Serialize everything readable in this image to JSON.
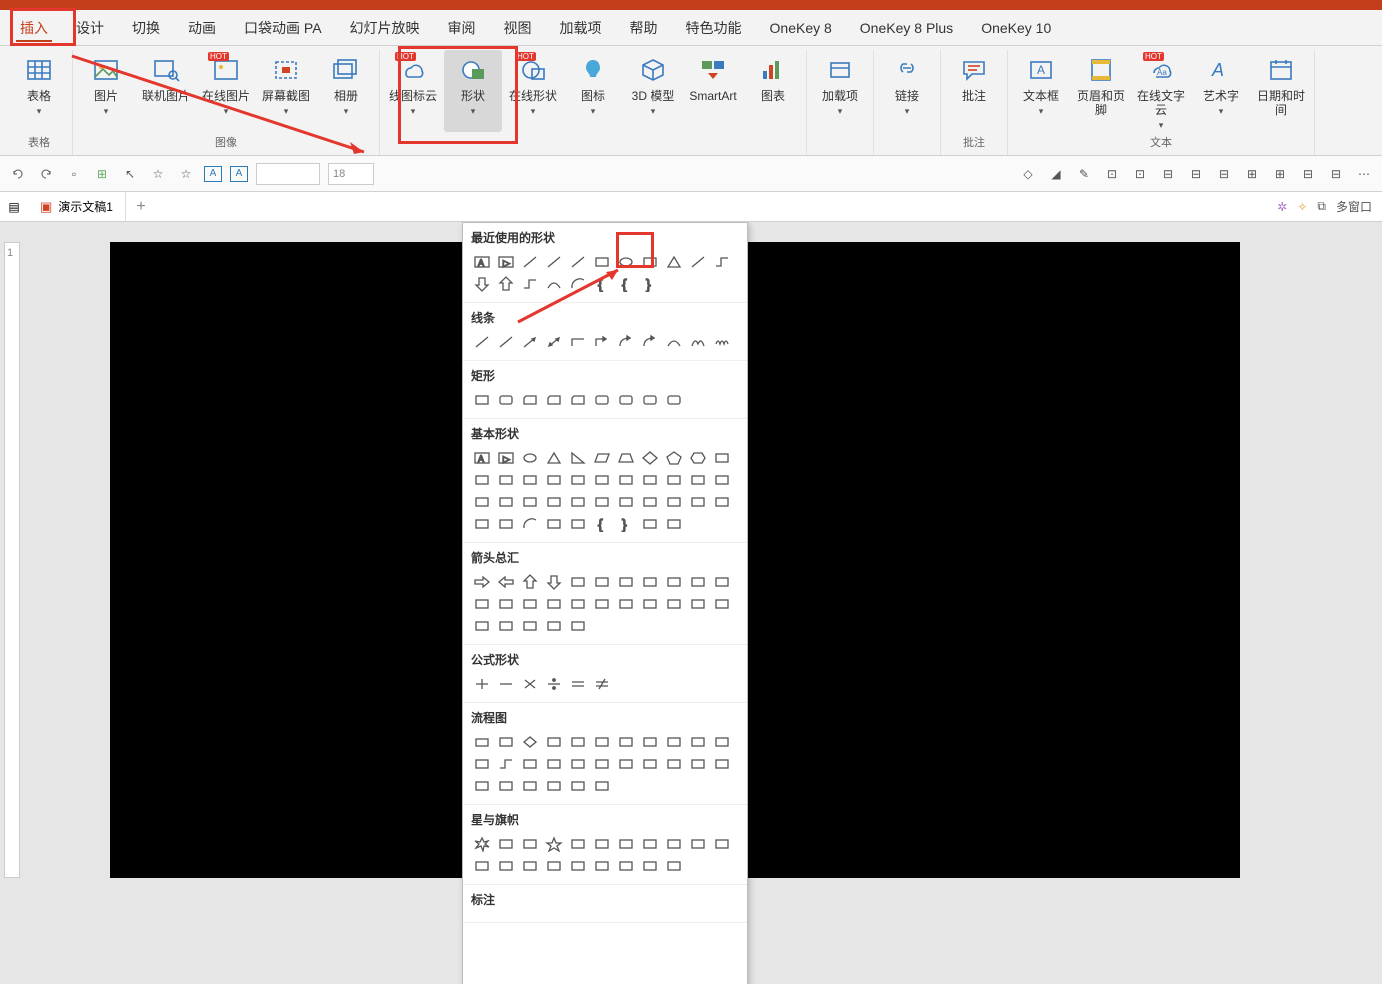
{
  "menubar": {
    "tabs": [
      "插入",
      "设计",
      "切换",
      "动画",
      "口袋动画 PA",
      "幻灯片放映",
      "审阅",
      "视图",
      "加载项",
      "帮助",
      "特色功能",
      "OneKey 8",
      "OneKey 8 Plus",
      "OneKey 10"
    ],
    "active_index": 0
  },
  "ribbon": {
    "groups": [
      {
        "name": "表格",
        "items": [
          {
            "label": "表格",
            "icon": "table",
            "chev": true
          }
        ]
      },
      {
        "name": "图像",
        "items": [
          {
            "label": "图片",
            "icon": "image",
            "chev": true
          },
          {
            "label": "联机图片",
            "icon": "image-search",
            "chev": false
          },
          {
            "label": "在线图片",
            "icon": "image-online",
            "chev": true,
            "hot": true
          },
          {
            "label": "屏幕截图",
            "icon": "screenshot",
            "chev": true
          },
          {
            "label": "相册",
            "icon": "album",
            "chev": true
          }
        ]
      },
      {
        "name": "",
        "items": [
          {
            "label": "线图标云",
            "icon": "cloud-icons",
            "chev": true,
            "hot": true
          },
          {
            "label": "形状",
            "icon": "shapes",
            "chev": true,
            "active": true
          },
          {
            "label": "在线形状",
            "icon": "shapes-online",
            "chev": true,
            "hot": true
          },
          {
            "label": "图标",
            "icon": "icons",
            "chev": true
          },
          {
            "label": "3D 模型",
            "icon": "3d",
            "chev": true
          },
          {
            "label": "SmartArt",
            "icon": "smartart",
            "chev": false
          },
          {
            "label": "图表",
            "icon": "chart",
            "chev": false
          }
        ]
      },
      {
        "name": "",
        "items": [
          {
            "label": "加载项",
            "icon": "addin",
            "chev": true
          }
        ]
      },
      {
        "name": "",
        "items": [
          {
            "label": "链接",
            "icon": "link",
            "chev": true
          }
        ]
      },
      {
        "name": "批注",
        "items": [
          {
            "label": "批注",
            "icon": "comment",
            "chev": false
          }
        ]
      },
      {
        "name": "文本",
        "items": [
          {
            "label": "文本框",
            "icon": "textbox",
            "chev": true
          },
          {
            "label": "页眉和页脚",
            "icon": "headerfooter",
            "chev": false
          },
          {
            "label": "在线文字云",
            "icon": "wordcloud",
            "chev": true,
            "hot": true
          },
          {
            "label": "艺术字",
            "icon": "wordart",
            "chev": true
          },
          {
            "label": "日期和时间",
            "icon": "datetime",
            "chev": false
          }
        ]
      }
    ]
  },
  "secondbar": {
    "font_size_placeholder": "18"
  },
  "doctab": {
    "title": "演示文稿1",
    "multiwindow": "多窗口"
  },
  "slide_marker": "1",
  "shape_popup": {
    "sections": [
      {
        "title": "最近使用的形状",
        "shapes": [
          "textbox-h",
          "textbox-v",
          "line",
          "line",
          "line",
          "rect",
          "oval",
          "rect",
          "triangle",
          "line",
          "connector",
          "arrow-down",
          "arrow-up",
          "connector",
          "curve",
          "arc",
          "brace-l",
          "brace-l",
          "brace-r"
        ]
      },
      {
        "title": "线条",
        "shapes": [
          "line",
          "line",
          "arrow",
          "arrow-2",
          "elbow",
          "elbow-arrow",
          "curve-arrow",
          "curve-arrow",
          "curve",
          "freeform",
          "scribble"
        ]
      },
      {
        "title": "矩形",
        "shapes": [
          "rect",
          "rounded-rect",
          "snip-rect",
          "snip-rect",
          "snip-rect",
          "rounded-rect",
          "rounded-rect",
          "rounded-rect",
          "rounded-rect"
        ]
      },
      {
        "title": "基本形状",
        "shapes": [
          "textbox-h",
          "textbox-v",
          "oval",
          "triangle",
          "right-triangle",
          "parallelogram",
          "trapezoid",
          "diamond",
          "pentagon",
          "hexagon",
          "heptagon",
          "octagon",
          "decagon",
          "dodecagon",
          "pie",
          "chord",
          "teardrop",
          "frame",
          "half-frame",
          "l-shape",
          "diag-stripe",
          "cross",
          "plaque",
          "can",
          "cube",
          "bevel",
          "donut",
          "no-symbol",
          "block-arc",
          "smiley",
          "heart",
          "lightning",
          "sun",
          "moon",
          "cloud",
          "arc",
          "bracket-l",
          "bracket-r",
          "brace-l",
          "brace-r",
          "bracket-pair",
          "brace-pair"
        ]
      },
      {
        "title": "箭头总汇",
        "shapes": [
          "arrow-r",
          "arrow-l",
          "arrow-u",
          "arrow-d",
          "arrow-lr",
          "arrow-ud",
          "quad-arrow",
          "tri-arrow",
          "bent-arrow",
          "u-turn",
          "left-up",
          "bent-up",
          "curved-r",
          "curved-l",
          "curved-u",
          "curved-d",
          "striped-r",
          "notched-r",
          "pentagon-r",
          "chevron",
          "callout-r",
          "callout-l",
          "callout-u",
          "callout-d",
          "callout-lr",
          "callout-quad",
          "circular"
        ]
      },
      {
        "title": "公式形状",
        "shapes": [
          "plus",
          "minus",
          "multiply",
          "divide",
          "equal",
          "not-equal"
        ]
      },
      {
        "title": "流程图",
        "shapes": [
          "process",
          "alt-process",
          "decision",
          "data",
          "predefined",
          "internal",
          "document",
          "multi-doc",
          "terminator",
          "preparation",
          "manual-input",
          "manual-op",
          "connector",
          "off-page",
          "card",
          "punched-tape",
          "summing",
          "or",
          "collate",
          "sort",
          "extract",
          "merge",
          "stored-data",
          "delay",
          "seq-access",
          "magnetic-disk",
          "direct-access",
          "display"
        ]
      },
      {
        "title": "星与旗帜",
        "shapes": [
          "explosion1",
          "explosion2",
          "star4",
          "star5",
          "star6",
          "star7",
          "star8",
          "star10",
          "star12",
          "star16",
          "star24",
          "star32",
          "ribbon-up",
          "ribbon-down",
          "ribbon-curved-up",
          "ribbon-curved-down",
          "wave",
          "double-wave",
          "vert-scroll",
          "horiz-scroll"
        ]
      },
      {
        "title": "标注",
        "shapes": []
      }
    ]
  }
}
